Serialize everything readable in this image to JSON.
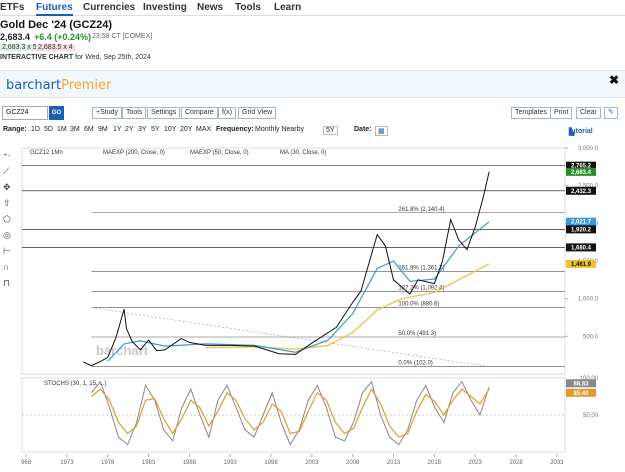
{
  "nav": {
    "items": [
      "ETFs",
      "Futures",
      "Currencies",
      "Investing",
      "News",
      "Tools",
      "Learn"
    ],
    "active": "Futures"
  },
  "quote": {
    "title": "Gold Dec '24 (GCZ24)",
    "price": "2,683.4",
    "change": "+6.4 (+0.24%)",
    "time": "23:58 CT [COMEX]",
    "bid": "2,683.3 x 5",
    "ask": "2,683.5 x 4",
    "chart_label": "INTERACTIVE CHART",
    "chart_date": "for Wed, Sep 25th, 2024"
  },
  "banner": {
    "logo_main": "barchart",
    "logo_premier": "Premier",
    "close": "✖"
  },
  "toolbar": {
    "symbol": "GCZ24",
    "go": "GO",
    "buttons": [
      "+Study",
      "Tools",
      "Settings",
      "Compare",
      "f(x)",
      "Grid View"
    ],
    "right_buttons": [
      "Templates",
      "Print",
      "Clear"
    ],
    "edit_icon": "✎"
  },
  "rangebar": {
    "range_label": "Range:",
    "ranges": [
      "1D",
      "5D",
      "1M",
      "3M",
      "6M",
      "9M",
      "1Y",
      "2Y",
      "3Y",
      "5Y",
      "10Y",
      "20Y",
      "MAX"
    ],
    "frequency_label": "Frequency:",
    "frequency": "Monthly Nearby",
    "period": "5Y",
    "date_label": "Date:",
    "tutorial": "tutorial"
  },
  "legend": {
    "main": "GCZ12 1Mn",
    "ma200": "MAEXP (200, Close, 0)",
    "ma50": "MAEXP (50, Close, 0)",
    "ma30": "MA (30, Close, 0)",
    "stoch": "STOCHS (30, 1, 15, ...)"
  },
  "watermark": "barchart",
  "colors": {
    "price": "#111111",
    "ma_blue": "#3a9ad9",
    "ma_gold": "#f0c030",
    "stoch_k": "#888888",
    "stoch_d": "#e39a2c",
    "accent": "#1a5fb4"
  },
  "chart_data": {
    "type": "line",
    "x_ticks": [
      "968",
      "1973",
      "1978",
      "1983",
      "1988",
      "1993",
      "1998",
      "2003",
      "2008",
      "2013",
      "2018",
      "2023",
      "2028",
      "2033"
    ],
    "y_ticks": [
      "3,000.0",
      "2,500.0",
      "2,000.0",
      "1,500.0",
      "1,000.0",
      "500.0"
    ],
    "ylim": [
      0,
      3000
    ],
    "price_series": [
      {
        "x": 1975,
        "y": 160
      },
      {
        "x": 1976,
        "y": 110
      },
      {
        "x": 1977,
        "y": 160
      },
      {
        "x": 1978,
        "y": 220
      },
      {
        "x": 1979,
        "y": 480
      },
      {
        "x": 1980,
        "y": 860
      },
      {
        "x": 1980.3,
        "y": 600
      },
      {
        "x": 1981,
        "y": 430
      },
      {
        "x": 1982,
        "y": 320
      },
      {
        "x": 1983,
        "y": 450
      },
      {
        "x": 1984,
        "y": 310
      },
      {
        "x": 1985,
        "y": 320
      },
      {
        "x": 1987,
        "y": 470
      },
      {
        "x": 1988,
        "y": 420
      },
      {
        "x": 1990,
        "y": 380
      },
      {
        "x": 1993,
        "y": 380
      },
      {
        "x": 1996,
        "y": 370
      },
      {
        "x": 1999,
        "y": 270
      },
      {
        "x": 2001,
        "y": 260
      },
      {
        "x": 2003,
        "y": 410
      },
      {
        "x": 2006,
        "y": 620
      },
      {
        "x": 2008,
        "y": 950
      },
      {
        "x": 2009,
        "y": 1100
      },
      {
        "x": 2011,
        "y": 1850
      },
      {
        "x": 2012,
        "y": 1700
      },
      {
        "x": 2013,
        "y": 1250
      },
      {
        "x": 2015,
        "y": 1060
      },
      {
        "x": 2016,
        "y": 1250
      },
      {
        "x": 2018,
        "y": 1200
      },
      {
        "x": 2019,
        "y": 1500
      },
      {
        "x": 2020,
        "y": 2050
      },
      {
        "x": 2021,
        "y": 1780
      },
      {
        "x": 2022,
        "y": 1650
      },
      {
        "x": 2023,
        "y": 1950
      },
      {
        "x": 2024,
        "y": 2350
      },
      {
        "x": 2024.7,
        "y": 2683
      }
    ],
    "ma_blue_series": [
      {
        "x": 1978,
        "y": 170
      },
      {
        "x": 1980,
        "y": 400
      },
      {
        "x": 1982,
        "y": 440
      },
      {
        "x": 1985,
        "y": 370
      },
      {
        "x": 1990,
        "y": 400
      },
      {
        "x": 1996,
        "y": 380
      },
      {
        "x": 2001,
        "y": 290
      },
      {
        "x": 2005,
        "y": 450
      },
      {
        "x": 2008,
        "y": 800
      },
      {
        "x": 2011,
        "y": 1400
      },
      {
        "x": 2013,
        "y": 1500
      },
      {
        "x": 2015,
        "y": 1230
      },
      {
        "x": 2018,
        "y": 1260
      },
      {
        "x": 2021,
        "y": 1700
      },
      {
        "x": 2024.7,
        "y": 2021
      }
    ],
    "ma_gold_series": [
      {
        "x": 1990,
        "y": 350
      },
      {
        "x": 1996,
        "y": 360
      },
      {
        "x": 2001,
        "y": 330
      },
      {
        "x": 2005,
        "y": 380
      },
      {
        "x": 2008,
        "y": 550
      },
      {
        "x": 2011,
        "y": 850
      },
      {
        "x": 2014,
        "y": 1000
      },
      {
        "x": 2018,
        "y": 1080
      },
      {
        "x": 2021,
        "y": 1250
      },
      {
        "x": 2024.7,
        "y": 1462
      }
    ],
    "fib_levels": [
      {
        "label": "261.8% (2,140.4)",
        "value": 2140.4
      },
      {
        "label": "161.8% (1,361.7)",
        "value": 1361.7
      },
      {
        "label": "127.2% (1,092.4)",
        "value": 1092.4
      },
      {
        "label": "100.0% (880.6)",
        "value": 880.6
      },
      {
        "label": "50.0% (491.3)",
        "value": 491.3
      },
      {
        "label": "0.0% (102.0)",
        "value": 102.0
      }
    ],
    "price_tags": [
      {
        "label": "2,765.2",
        "value": 2765.2,
        "color": "#111111"
      },
      {
        "label": "2,683.4",
        "value": 2683.4,
        "color": "#2a8f2a"
      },
      {
        "label": "2,432.3",
        "value": 2432.3,
        "color": "#111111"
      },
      {
        "label": "2,021.7",
        "value": 2021.7,
        "color": "#3a9ad9"
      },
      {
        "label": "1,920.2",
        "value": 1920.2,
        "color": "#111111"
      },
      {
        "label": "1,680.4",
        "value": 1680.4,
        "color": "#111111"
      },
      {
        "label": "1,461.9",
        "value": 1461.9,
        "color": "#f0c030"
      }
    ],
    "stoch": {
      "y_ticks": [
        "100.00",
        "50.00"
      ],
      "tags": [
        {
          "label": "88.83",
          "color": "#888888"
        },
        {
          "label": "85.40",
          "color": "#e39a2c"
        }
      ],
      "k_values": [
        80,
        95,
        60,
        20,
        10,
        40,
        90,
        70,
        30,
        15,
        60,
        85,
        50,
        20,
        70,
        90,
        60,
        30,
        20,
        50,
        80,
        40,
        10,
        30,
        70,
        90,
        60,
        20,
        15,
        40,
        80,
        95,
        50,
        20,
        10,
        30,
        70,
        90,
        60,
        40,
        80,
        95,
        70,
        50,
        88
      ],
      "d_values": [
        75,
        85,
        70,
        40,
        25,
        35,
        70,
        72,
        45,
        25,
        45,
        70,
        60,
        35,
        55,
        80,
        70,
        45,
        30,
        40,
        65,
        55,
        25,
        28,
        55,
        80,
        70,
        40,
        25,
        32,
        60,
        85,
        65,
        35,
        20,
        25,
        55,
        78,
        68,
        50,
        70,
        85,
        75,
        65,
        85
      ]
    }
  }
}
